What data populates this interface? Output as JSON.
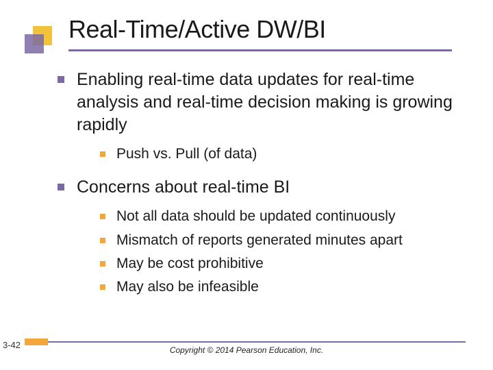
{
  "title": "Real-Time/Active DW/BI",
  "bullets": [
    {
      "text": "Enabling real-time data updates for real-time analysis and real-time decision making is growing rapidly",
      "sub": [
        "Push vs. Pull (of data)"
      ]
    },
    {
      "text": "Concerns about real-time BI",
      "sub": [
        "Not all data should be updated continuously",
        "Mismatch of reports generated minutes apart",
        "May be cost prohibitive",
        "May also be infeasible"
      ]
    }
  ],
  "footer": {
    "slide_number": "3-42",
    "copyright": "Copyright © 2014 Pearson Education, Inc."
  }
}
